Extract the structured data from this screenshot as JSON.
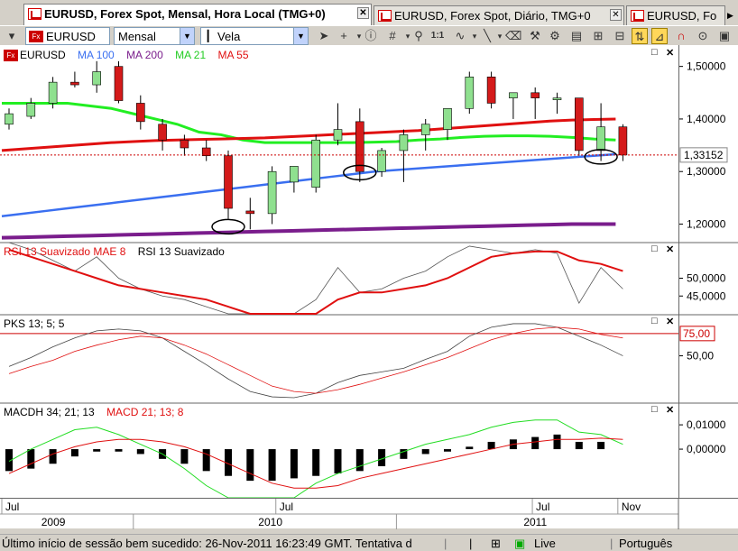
{
  "tabs": [
    {
      "title": "EURUSD, Forex Spot, Mensal, Hora Local (TMG+0)",
      "active": true
    },
    {
      "title": "EURUSD, Forex Spot, Diário, TMG+0",
      "active": false
    },
    {
      "title": "EURUSD, Fo",
      "active": false
    }
  ],
  "toolbar": {
    "symbol": "EURUSD",
    "period": "Mensal",
    "chart_type": "Vela",
    "icons": [
      "cursor-icon",
      "crosshair-icon",
      "info-icon",
      "grid-icon",
      "zoom-icon",
      "one-to-one-icon",
      "wave-icon",
      "line-tool-icon",
      "eraser-icon",
      "tools-icon",
      "settings-icon",
      "layout-icon",
      "scale-icon",
      "magnet-icon",
      "arrows-icon"
    ],
    "one_to_one": "1:1"
  },
  "price_panel": {
    "legend": [
      {
        "label": "EURUSD",
        "color": "#000000"
      },
      {
        "label": "MA 100",
        "color": "#3a6ff0"
      },
      {
        "label": "MA 200",
        "color": "#7a1d8c"
      },
      {
        "label": "MA 21",
        "color": "#22cc22"
      },
      {
        "label": "MA 55",
        "color": "#e01010"
      }
    ],
    "axis_labels": [
      "1,50000",
      "1,40000",
      "1,30000",
      "1,20000"
    ],
    "current_price": "1,33152",
    "ma_overlay_levels": {
      "ma200": [
        1.174,
        1.18,
        1.186,
        1.192,
        1.197,
        1.2
      ],
      "ma100": [
        1.215,
        1.245,
        1.27,
        1.29,
        1.305,
        1.318,
        1.33,
        1.335
      ]
    }
  },
  "rsi_panel": {
    "title": "RSI 13 Suavizado MAE 8",
    "title_color": "#e01010",
    "title2": "RSI 13 Suavizado",
    "axis_labels": [
      "50,0000",
      "45,0000"
    ]
  },
  "pks_panel": {
    "title": "PKS 13; 5; 5",
    "level": "75,00",
    "axis_labels": [
      "50,00"
    ]
  },
  "macd_panel": {
    "title": "MACDH 34; 21; 13",
    "title2": "MACD 21; 13; 8",
    "title2_color": "#e01010",
    "axis_labels": [
      "0,01000",
      "0,00000"
    ]
  },
  "xaxis": {
    "months": [
      "Jul",
      "Jul",
      "Jul",
      "Nov"
    ],
    "years": [
      "2009",
      "2010",
      "2011"
    ]
  },
  "status": {
    "message": "Último início de sessão bem sucedido: 26-Nov-2011 16:23:49 GMT. Tentativa d",
    "live": "Live",
    "language": "Português"
  },
  "chart_data": {
    "type": "candlestick",
    "title": "EURUSD, Forex Spot, Mensal, Hora Local (TMG+0)",
    "xlabel": "",
    "ylabel": "",
    "ylim": [
      1.17,
      1.52
    ],
    "x_ticks": [
      "Jul 2009",
      "Jul 2010",
      "Jul 2011",
      "Nov"
    ],
    "series": [
      {
        "name": "EURUSD",
        "ohlc": [
          [
            1.39,
            1.42,
            1.38,
            1.41
          ],
          [
            1.405,
            1.44,
            1.4,
            1.43
          ],
          [
            1.43,
            1.48,
            1.42,
            1.47
          ],
          [
            1.47,
            1.49,
            1.46,
            1.465
          ],
          [
            1.465,
            1.51,
            1.45,
            1.49
          ],
          [
            1.5,
            1.51,
            1.43,
            1.435
          ],
          [
            1.43,
            1.445,
            1.38,
            1.395
          ],
          [
            1.39,
            1.4,
            1.34,
            1.36
          ],
          [
            1.36,
            1.37,
            1.33,
            1.345
          ],
          [
            1.345,
            1.36,
            1.32,
            1.33
          ],
          [
            1.33,
            1.34,
            1.21,
            1.23
          ],
          [
            1.225,
            1.25,
            1.19,
            1.22
          ],
          [
            1.22,
            1.31,
            1.2,
            1.3
          ],
          [
            1.28,
            1.31,
            1.26,
            1.31
          ],
          [
            1.27,
            1.37,
            1.26,
            1.36
          ],
          [
            1.36,
            1.43,
            1.35,
            1.38
          ],
          [
            1.395,
            1.42,
            1.28,
            1.3
          ],
          [
            1.3,
            1.345,
            1.29,
            1.34
          ],
          [
            1.34,
            1.38,
            1.28,
            1.37
          ],
          [
            1.37,
            1.4,
            1.34,
            1.39
          ],
          [
            1.38,
            1.42,
            1.36,
            1.42
          ],
          [
            1.42,
            1.49,
            1.41,
            1.48
          ],
          [
            1.48,
            1.49,
            1.42,
            1.43
          ],
          [
            1.44,
            1.45,
            1.4,
            1.45
          ],
          [
            1.45,
            1.46,
            1.4,
            1.44
          ],
          [
            1.44,
            1.45,
            1.41,
            1.44
          ],
          [
            1.44,
            1.43,
            1.33,
            1.34
          ],
          [
            1.34,
            1.43,
            1.32,
            1.385
          ],
          [
            1.385,
            1.39,
            1.32,
            1.3315
          ]
        ]
      },
      {
        "name": "MA 21",
        "values": [
          1.43,
          1.43,
          1.43,
          1.43,
          1.425,
          1.42,
          1.41,
          1.4,
          1.39,
          1.375,
          1.37,
          1.36,
          1.355,
          1.355,
          1.355,
          1.355,
          1.355,
          1.356,
          1.357,
          1.36,
          1.362,
          1.365,
          1.367,
          1.368,
          1.368,
          1.367,
          1.365,
          1.362,
          1.36
        ]
      },
      {
        "name": "MA 55",
        "values": [
          1.34,
          1.343,
          1.346,
          1.349,
          1.352,
          1.355,
          1.357,
          1.359,
          1.36,
          1.361,
          1.362,
          1.363,
          1.364,
          1.366,
          1.368,
          1.37,
          1.372,
          1.374,
          1.376,
          1.378,
          1.381,
          1.384,
          1.387,
          1.39,
          1.393,
          1.396,
          1.398,
          1.399,
          1.4
        ]
      },
      {
        "name": "MA 100",
        "values": [
          1.215,
          1.22,
          1.225,
          1.23,
          1.235,
          1.24,
          1.245,
          1.25,
          1.255,
          1.26,
          1.265,
          1.27,
          1.275,
          1.28,
          1.285,
          1.29,
          1.295,
          1.3,
          1.303,
          1.306,
          1.309,
          1.312,
          1.315,
          1.318,
          1.321,
          1.324,
          1.327,
          1.33,
          1.333
        ]
      },
      {
        "name": "MA 200",
        "values": [
          1.174,
          1.175,
          1.176,
          1.177,
          1.178,
          1.179,
          1.18,
          1.181,
          1.182,
          1.183,
          1.184,
          1.185,
          1.186,
          1.187,
          1.188,
          1.189,
          1.19,
          1.191,
          1.192,
          1.193,
          1.194,
          1.195,
          1.196,
          1.197,
          1.198,
          1.199,
          1.2,
          1.2,
          1.2
        ]
      }
    ],
    "rsi": {
      "red": [
        58,
        56,
        54,
        52,
        50,
        48,
        47,
        46,
        45,
        44,
        42,
        40,
        38,
        37,
        39,
        44,
        46,
        46,
        47,
        48,
        50,
        53,
        56,
        57,
        57.5,
        57.5,
        55,
        54,
        52
      ],
      "gray": [
        60,
        58,
        55,
        52,
        56,
        50,
        47,
        45,
        44,
        42,
        38,
        36,
        35,
        38,
        44,
        53,
        46,
        47,
        50,
        52,
        56,
        59,
        58,
        57,
        58,
        57,
        43,
        53,
        47
      ]
    },
    "pks": {
      "red": [
        30,
        38,
        45,
        55,
        62,
        68,
        72,
        70,
        62,
        52,
        40,
        28,
        16,
        10,
        8,
        12,
        18,
        25,
        32,
        40,
        48,
        58,
        68,
        75,
        80,
        82,
        80,
        74,
        70
      ],
      "gray": [
        38,
        48,
        60,
        70,
        78,
        80,
        78,
        70,
        55,
        40,
        24,
        10,
        4,
        3,
        8,
        20,
        28,
        32,
        36,
        46,
        55,
        72,
        82,
        86,
        86,
        82,
        72,
        62,
        50
      ]
    },
    "macd": {
      "histogram": [
        -0.009,
        -0.008,
        -0.006,
        -0.003,
        -0.001,
        -0.001,
        -0.002,
        -0.004,
        -0.006,
        -0.009,
        -0.011,
        -0.013,
        -0.013,
        -0.012,
        -0.011,
        -0.01,
        -0.009,
        -0.007,
        -0.004,
        -0.002,
        -0.001,
        0.001,
        0.003,
        0.004,
        0.005,
        0.006,
        0.003,
        0.003,
        0
      ],
      "green": [
        -0.005,
        0,
        0.004,
        0.008,
        0.009,
        0.006,
        0.002,
        -0.002,
        -0.008,
        -0.015,
        -0.02,
        -0.025,
        -0.024,
        -0.02,
        -0.014,
        -0.01,
        -0.007,
        -0.004,
        -0.001,
        0.002,
        0.004,
        0.006,
        0.009,
        0.011,
        0.012,
        0.012,
        0.007,
        0.006,
        0.002
      ],
      "red": [
        -0.01,
        -0.006,
        -0.002,
        0.001,
        0.003,
        0.004,
        0.004,
        0.003,
        0.001,
        -0.002,
        -0.006,
        -0.01,
        -0.014,
        -0.016,
        -0.016,
        -0.015,
        -0.012,
        -0.01,
        -0.008,
        -0.006,
        -0.004,
        -0.002,
        0,
        0.002,
        0.003,
        0.004,
        0.004,
        0.0045,
        0.004
      ]
    }
  }
}
